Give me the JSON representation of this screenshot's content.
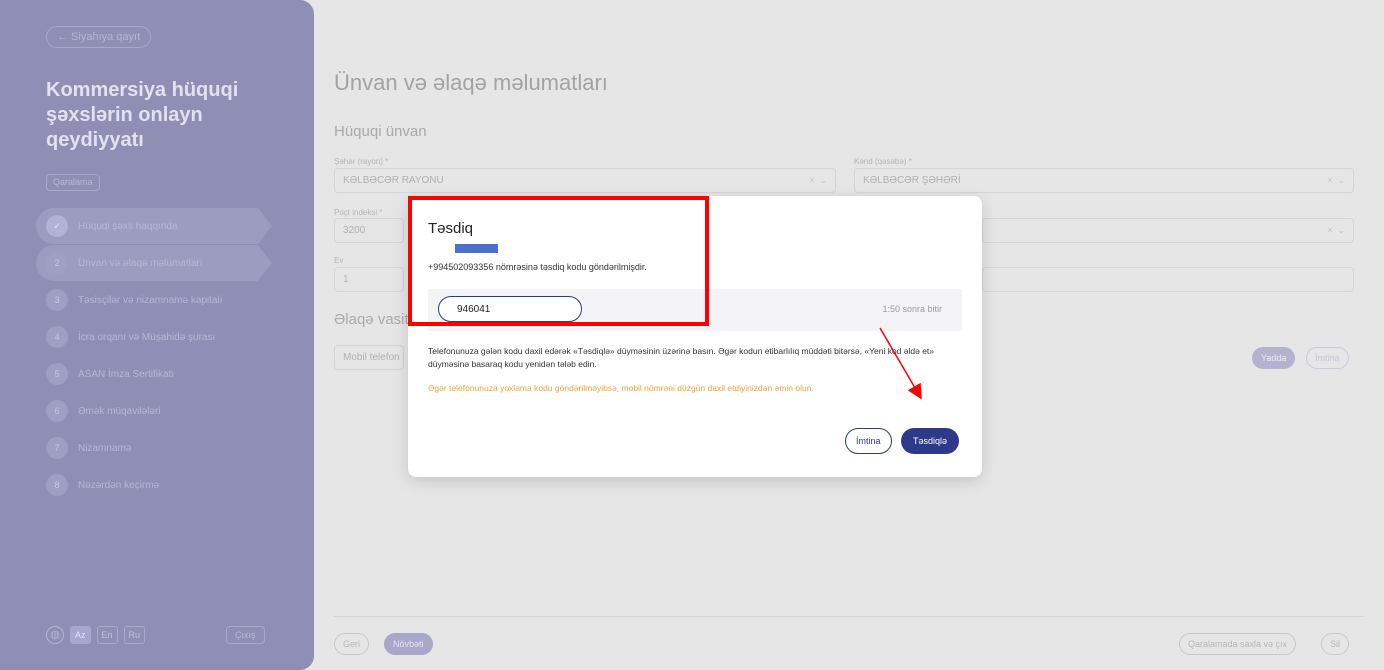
{
  "sidebar": {
    "back_label": "← Siyahıya qayıt",
    "title": "Kommersiya hüquqi şəxslərin onlayn qeydiyyatı",
    "badge": "Qaralama",
    "steps": [
      {
        "num": "✓",
        "label": "Hüquqi şəxs haqqında"
      },
      {
        "num": "2",
        "label": "Ünvan və əlaqə məlumatları"
      },
      {
        "num": "3",
        "label": "Təsisçilər və nizamnamə kapitalı"
      },
      {
        "num": "4",
        "label": "İcra orqanı və Müşahidə şurası"
      },
      {
        "num": "5",
        "label": "ASAN İmza Sertifikatı"
      },
      {
        "num": "6",
        "label": "Əmək müqavilələri"
      },
      {
        "num": "7",
        "label": "Nizamnamə"
      },
      {
        "num": "8",
        "label": "Nəzərdən keçirmə"
      }
    ],
    "langs": [
      "Az",
      "En",
      "Ru"
    ],
    "exit_label": "Çıxış"
  },
  "main": {
    "title": "Ünvan və əlaqə məlumatları",
    "address_section": "Hüquqi ünvan",
    "city_label": "Şəhər (rayon) *",
    "city_value": "KƏLBƏCƏR RAYONU",
    "village_label": "Kənd (qəsəbə) *",
    "village_value": "KƏLBƏCƏR ŞƏHƏRİ",
    "postal_label": "Poçt indeksi *",
    "postal_value": "3200",
    "house_label": "Ev",
    "house_value": "1",
    "contact_section": "Əlaqə vasitələri",
    "mobile_placeholder": "Mobil telefon",
    "save_label": "Yadda",
    "cancel_label": "İmtina",
    "back_btn": "Geri",
    "next_btn": "Növbəti",
    "draft_btn": "Qaralamada saxla və çıx",
    "delete_btn": "Sil"
  },
  "modal": {
    "title": "Təsdiq",
    "sent_text": "+994502093356 nömrəsinə təsdiq kodu göndərilmişdir.",
    "code_value": "946041",
    "timer": "1:50 sonra bitir",
    "info_text": "Telefonunuza gələn kodu daxil edərək «Təsdiqlə» düyməsinin üzərinə basın. Əgər kodun etibarlılıq müddəti bitərsə, «Yeni kod əldə et» düyməsinə basaraq kodu yenidən tələb edin.",
    "warning_text": "Əgər telefonunuza yoxlama kodu göndərilməyibsə, mobil nömrəni düzgün daxil etdiyinizdən əmin olun.",
    "cancel_label": "İmtina",
    "confirm_label": "Təsdiqlə"
  },
  "colors": {
    "sidebar_bg": "#8f8fb6",
    "primary": "#2d3a8c",
    "warning": "#f0a23a",
    "annotation": "#ff0000",
    "redaction": "#4b6fcf"
  }
}
